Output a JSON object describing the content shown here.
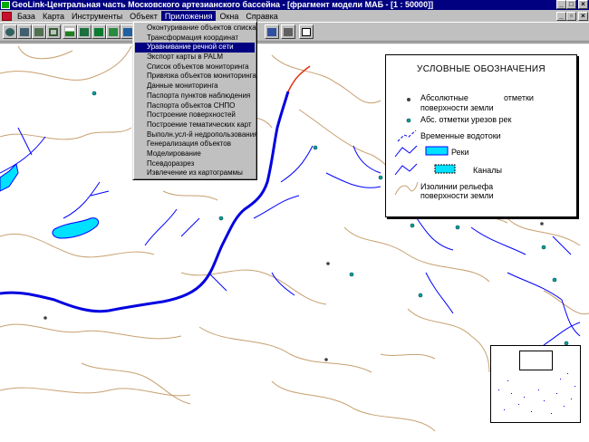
{
  "window": {
    "title": "GeoLink-Центральная часть Московского артезианского бассейна - [фрагмент модели МАБ - [1 : 50000]]",
    "controls": [
      "_",
      "□",
      "×"
    ]
  },
  "menubar": {
    "items": [
      {
        "id": "baza",
        "label": "База"
      },
      {
        "id": "karta",
        "label": "Карта"
      },
      {
        "id": "instr",
        "label": "Инструменты"
      },
      {
        "id": "obekt",
        "label": "Объект"
      },
      {
        "id": "pril",
        "label": "Приложения"
      },
      {
        "id": "okna",
        "label": "Окна"
      },
      {
        "id": "sprav",
        "label": "Справка"
      }
    ],
    "active": "Приложения",
    "mdi_controls": [
      "_",
      "▫",
      "×"
    ]
  },
  "toolbar": {
    "buttons": [
      "zoom-in-icon",
      "zoom-out-icon",
      "pan-icon",
      "select-icon",
      "layer-icon",
      "table-icon",
      "chart-icon",
      "map-icon",
      "report-icon",
      "grid-icon",
      "print-icon",
      "help-icon"
    ]
  },
  "dropdown": {
    "items": [
      "Оконтуривание объектов списка",
      "Трансформация координат",
      "Уравнивание речной сети",
      "Экспорт карты в PALM",
      "Список объектов мониторинга",
      "Привязка объектов мониторинга",
      "Данные мониторинга",
      "Паспорта пунктов наблюдения",
      "Паспорта объектов СНПО",
      "Построение поверхностей",
      "Построение тематических карт",
      "Выполн.усл-й недропользования",
      "Генерализация объектов",
      "Моделирование",
      "Псевдоразрез",
      "Извлечение из картограммы"
    ],
    "highlighted_index": 2
  },
  "legend": {
    "title": "УСЛОВНЫЕ ОБОЗНАЧЕНИЯ",
    "abs_marks_1": "Абсолютные",
    "abs_marks_2": "отметки",
    "abs_marks_3": "поверхности земли",
    "edge_marks": "Абс. отметки урезов рек",
    "temp_streams": "Временные водотоки",
    "rivers": "Реки",
    "canals": "Каналы",
    "contours_1": "Изолинии рельефа",
    "contours_2": "поверхности земли"
  },
  "colors": {
    "river": "#0000ff",
    "main_river": "#0000e0",
    "water_fill": "#00e0ff",
    "contour": "#c8a070",
    "highlight_river": "#e03010",
    "menu_highlight": "#000080"
  }
}
